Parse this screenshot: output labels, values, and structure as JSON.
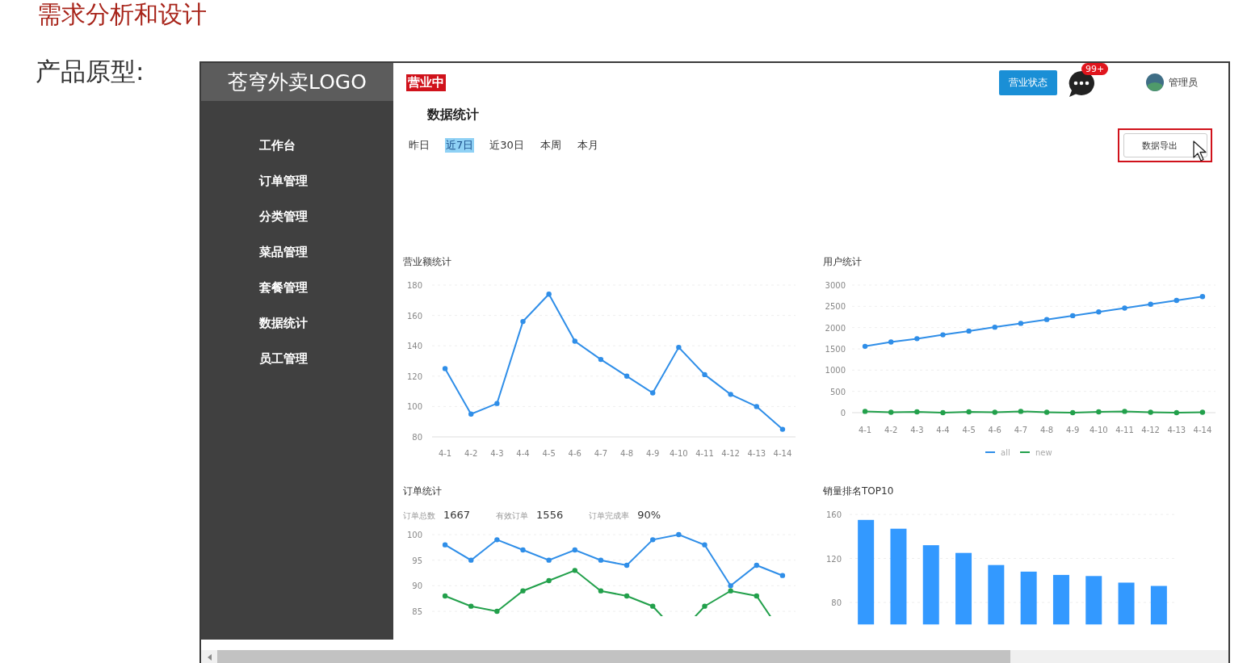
{
  "slide": {
    "title": "需求分析和设计",
    "label": "产品原型:"
  },
  "sidebar": {
    "logo": "苍穹外卖LOGO",
    "items": [
      {
        "label": "工作台"
      },
      {
        "label": "订单管理"
      },
      {
        "label": "分类管理"
      },
      {
        "label": "菜品管理"
      },
      {
        "label": "套餐管理"
      },
      {
        "label": "数据统计"
      },
      {
        "label": "员工管理"
      }
    ]
  },
  "header": {
    "status_badge": "营业中",
    "status_button": "营业状态",
    "message_count": "99+",
    "user": "管理员"
  },
  "page_title": "数据统计",
  "tabs": [
    {
      "label": "昨日",
      "selected": false
    },
    {
      "label": "近7日",
      "selected": true
    },
    {
      "label": "近30日",
      "selected": false
    },
    {
      "label": "本周",
      "selected": false
    },
    {
      "label": "本月",
      "selected": false
    }
  ],
  "export_button": "数据导出",
  "turnover": {
    "chart_data": {
      "type": "line",
      "title": "营业额统计",
      "categories": [
        "4-1",
        "4-2",
        "4-3",
        "4-4",
        "4-5",
        "4-6",
        "4-7",
        "4-8",
        "4-9",
        "4-10",
        "4-11",
        "4-12",
        "4-13",
        "4-14"
      ],
      "ylim": [
        80,
        180
      ],
      "yticks": [
        80,
        100,
        120,
        140,
        160,
        180
      ],
      "grid": true,
      "series": [
        {
          "color": "#2f8ee8",
          "marker": "circle",
          "values": [
            125,
            95,
            102,
            156,
            174,
            143,
            131,
            120,
            109,
            139,
            121,
            108,
            100,
            85
          ]
        }
      ]
    }
  },
  "users": {
    "chart_data": {
      "type": "line",
      "title": "用户统计",
      "categories": [
        "4-1",
        "4-2",
        "4-3",
        "4-4",
        "4-5",
        "4-6",
        "4-7",
        "4-8",
        "4-9",
        "4-10",
        "4-11",
        "4-12",
        "4-13",
        "4-14"
      ],
      "ylim": [
        0,
        3000
      ],
      "yticks": [
        0,
        500,
        1000,
        1500,
        2000,
        2500,
        3000
      ],
      "grid": true,
      "legend": "bottom",
      "series": [
        {
          "name": "all",
          "color": "#2f8ee8",
          "marker": "circle",
          "values": [
            1560,
            1660,
            1740,
            1830,
            1920,
            2010,
            2100,
            2190,
            2280,
            2370,
            2460,
            2550,
            2640,
            2730
          ]
        },
        {
          "name": "new",
          "color": "#22a04b",
          "marker": "circle",
          "values": [
            30,
            10,
            20,
            0,
            20,
            10,
            30,
            10,
            0,
            20,
            30,
            10,
            0,
            10
          ]
        }
      ]
    }
  },
  "orders": {
    "summary": [
      {
        "label": "订单总数",
        "value": "1667"
      },
      {
        "label": "有效订单",
        "value": "1556"
      },
      {
        "label": "订单完成率",
        "value": "90%"
      }
    ],
    "chart_data": {
      "type": "line",
      "title": "订单统计",
      "ylim": [
        85,
        100
      ],
      "yticks": [
        85,
        90,
        95,
        100
      ],
      "grid": true,
      "series": [
        {
          "color": "#2f8ee8",
          "marker": "circle",
          "values": [
            98,
            95,
            99,
            97,
            95,
            97,
            95,
            94,
            99,
            100,
            98,
            90,
            94,
            92
          ]
        },
        {
          "color": "#22a04b",
          "marker": "circle",
          "values": [
            88,
            86,
            85,
            89,
            91,
            93,
            89,
            88,
            86,
            null,
            86,
            89,
            88,
            null
          ]
        }
      ]
    }
  },
  "top10": {
    "chart_data": {
      "type": "bar",
      "title": "销量排名TOP10",
      "ylim": [
        60,
        160
      ],
      "yticks": [
        80,
        120,
        160
      ],
      "grid": true,
      "series": [
        {
          "color": "#3399ff",
          "values": [
            155,
            147,
            132,
            125,
            114,
            108,
            105,
            104,
            98,
            95
          ]
        }
      ]
    }
  }
}
